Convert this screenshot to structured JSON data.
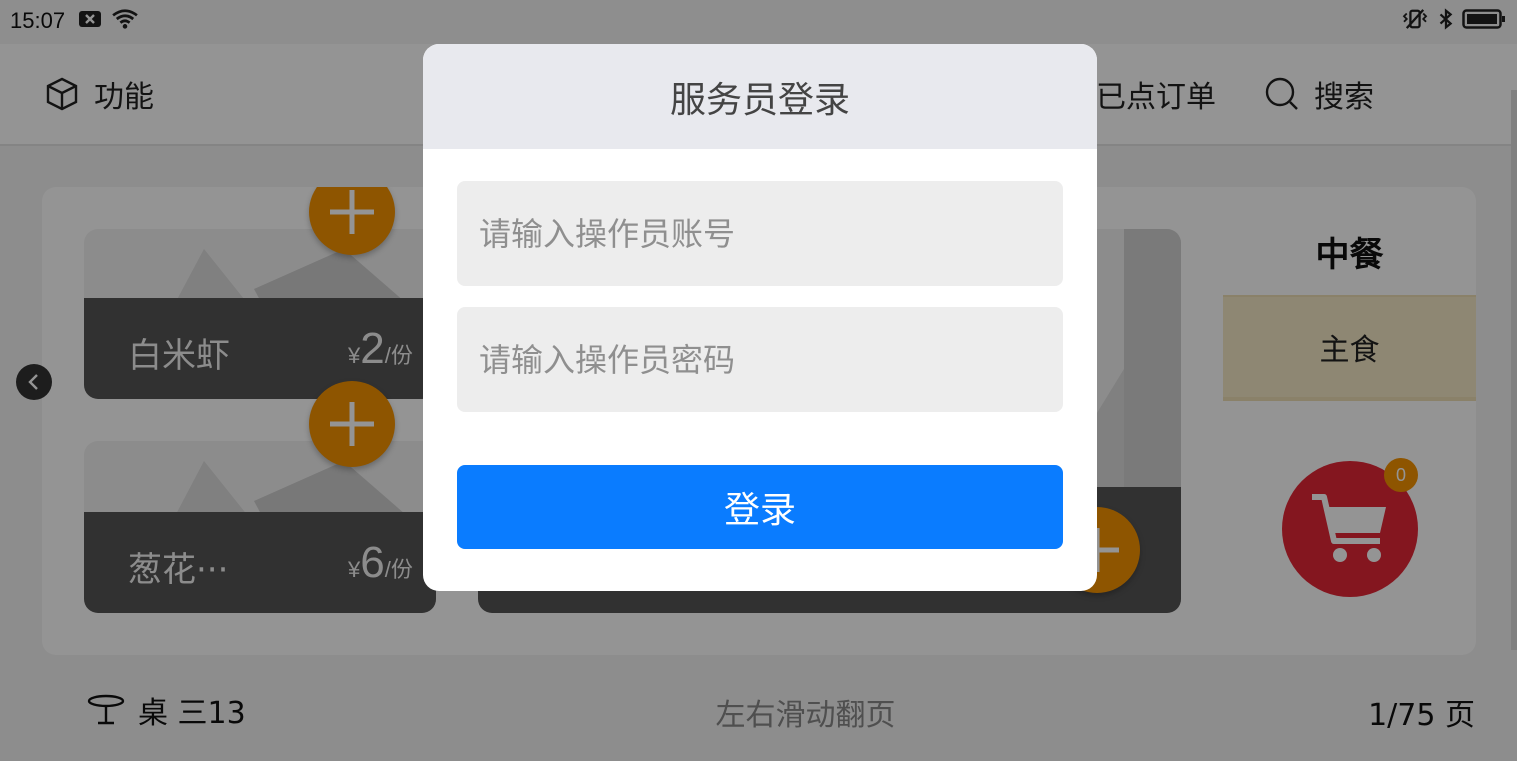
{
  "status_bar": {
    "time": "15:07",
    "icons": [
      "notification-x-icon",
      "wifi-icon",
      "vibrate-icon",
      "bluetooth-icon",
      "battery-icon"
    ]
  },
  "top_bar": {
    "function_label": "功能",
    "orders_label": "已点订单",
    "search_label": "搜索"
  },
  "dishes": [
    {
      "name": "白米虾",
      "price_symbol": "¥",
      "price": "2",
      "unit": "/份"
    },
    {
      "name": "葱花···",
      "price_symbol": "¥",
      "price": "6",
      "unit": "/份"
    }
  ],
  "side": {
    "meal_label": "中餐",
    "category": "主食",
    "cart_count": "0"
  },
  "bottom_bar": {
    "table": "桌 三13",
    "hint": "左右滑动翻页",
    "page": "1/75 页"
  },
  "login_dialog": {
    "title": "服务员登录",
    "account_placeholder": "请输入操作员账号",
    "password_placeholder": "请输入操作员密码",
    "login_label": "登录"
  },
  "colors": {
    "accent_orange": "#f59300",
    "cart_red": "#e32636",
    "login_blue": "#0a7cff",
    "category_bg": "#f5e8c7"
  }
}
